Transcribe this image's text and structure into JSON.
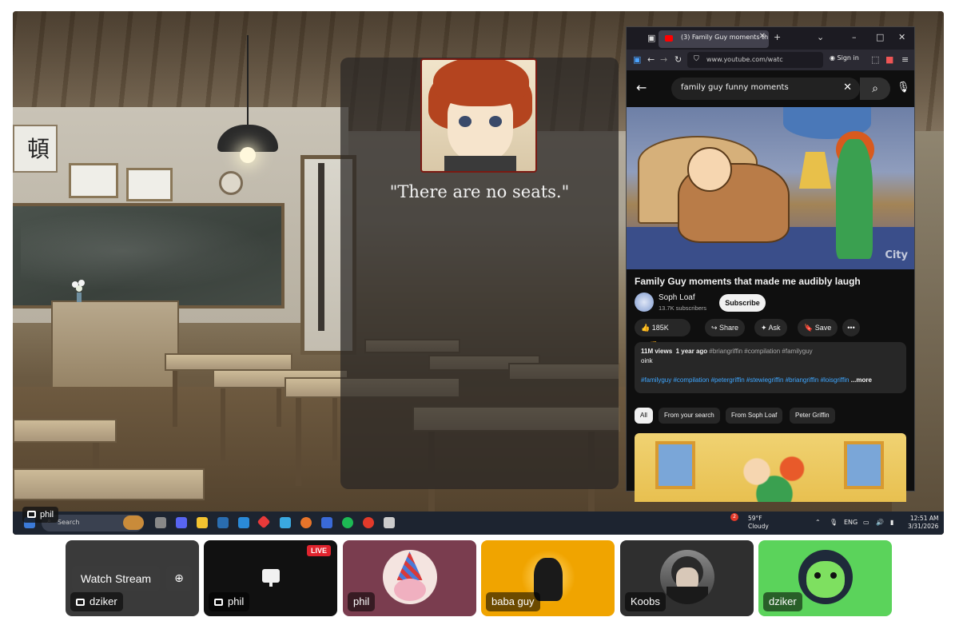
{
  "game": {
    "dialogue": "\"There are no seats.\"",
    "sign_text": "頓"
  },
  "browser": {
    "tab_title": "(3) Family Guy moments th",
    "url": "www.youtube.com/watc",
    "signin_label": "Sign in"
  },
  "youtube": {
    "search_query": "family guy funny moments",
    "video_watermark": "City",
    "video_title": "Family Guy moments that made me audibly laugh",
    "channel_name": "Soph Loaf",
    "channel_subs": "13.7K subscribers",
    "subscribe_label": "Subscribe",
    "likes": "185K",
    "share_label": "Share",
    "ask_label": "Ask",
    "save_label": "Save",
    "more_label": "•••",
    "description_meta": "11M views",
    "description_age": "1 year ago",
    "description_tags_top": "#briangriffin #compilation #familyguy",
    "description_text": "oink",
    "description_tags_bottom": "#familyguy #compilation #petergriffin #stewiegriffin #briangriffin #loisgriffin",
    "description_more": "...more",
    "chips": [
      "All",
      "From your search",
      "From Soph Loaf",
      "Peter Griffin"
    ]
  },
  "taskbar": {
    "search_placeholder": "Search",
    "weather_temp": "59°F",
    "weather_desc": "Cloudy",
    "weather_badge": "2",
    "language": "ENG",
    "time": "12:51 AM",
    "date": "3/31/2026"
  },
  "stream_label": "phil",
  "tiles": [
    {
      "name": "dziker",
      "watch_label": "Watch Stream"
    },
    {
      "name": "phil",
      "live": "LIVE"
    },
    {
      "name": "phil"
    },
    {
      "name": "baba guy"
    },
    {
      "name": "Koobs"
    },
    {
      "name": "dziker"
    }
  ],
  "colors": {
    "live_red": "#e0242e",
    "tile_phil_bg": "#7a3d4f",
    "tile_baba_bg": "#f0a400",
    "tile_dziker_bg": "#5bd35b",
    "youtube_link": "#3ea6ff"
  }
}
